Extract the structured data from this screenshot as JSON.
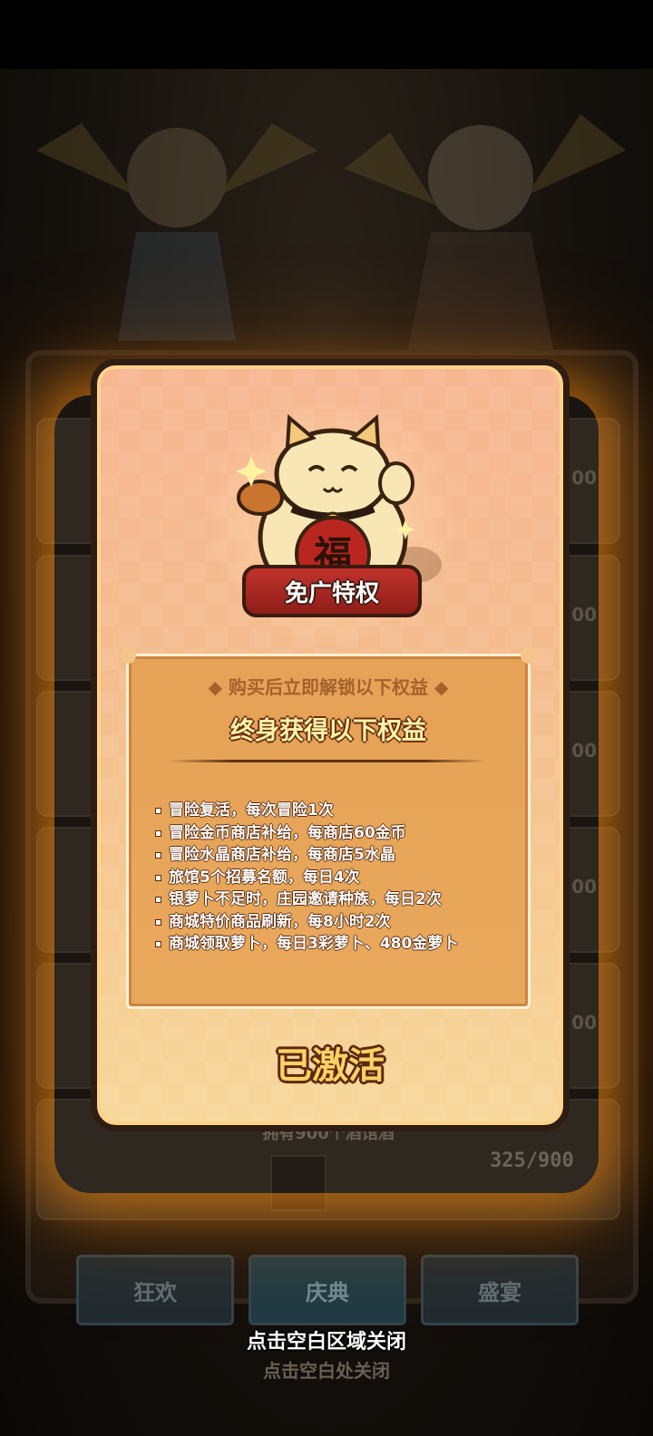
{
  "modal": {
    "badge_label": "免广特权",
    "panel_header": "◆ 购买后立即解锁以下权益 ◆",
    "panel_title": "终身获得以下权益",
    "benefits": [
      "冒险复活，每次冒险1次",
      "冒险金币商店补给，每商店60金币",
      "冒险水晶商店补给，每商店5水晶",
      "旅馆5个招募名额，每日4次",
      "银萝卜不足时，庄园邀请种族，每日2次",
      "商城特价商品刷新，每8小时2次",
      "商城领取萝卜，每日3彩萝卜、480金萝卜"
    ],
    "status_label": "已激活",
    "cat_chest_char": "福"
  },
  "overlay": {
    "close_hint": "点击空白区域关闭"
  },
  "background": {
    "progress_label": "325/900",
    "owned_text": "拥有900个酒馆酒",
    "close_hint_dim": "点击空白处关闭",
    "tabs": [
      "狂欢",
      "庆典",
      "盛宴"
    ]
  },
  "colors": {
    "modal_glow": "#ff9614",
    "title_yellow": "#fff3a8",
    "status_gold": "#ffd066",
    "badge_red": "#c1322c"
  }
}
